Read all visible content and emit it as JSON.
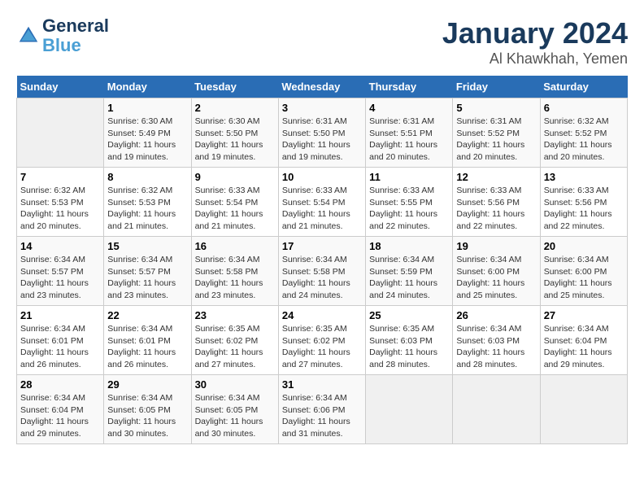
{
  "header": {
    "logo_line1": "General",
    "logo_line2": "Blue",
    "month": "January 2024",
    "location": "Al Khawkhah, Yemen"
  },
  "days_of_week": [
    "Sunday",
    "Monday",
    "Tuesday",
    "Wednesday",
    "Thursday",
    "Friday",
    "Saturday"
  ],
  "weeks": [
    [
      {
        "day": "",
        "info": ""
      },
      {
        "day": "1",
        "info": "Sunrise: 6:30 AM\nSunset: 5:49 PM\nDaylight: 11 hours\nand 19 minutes."
      },
      {
        "day": "2",
        "info": "Sunrise: 6:30 AM\nSunset: 5:50 PM\nDaylight: 11 hours\nand 19 minutes."
      },
      {
        "day": "3",
        "info": "Sunrise: 6:31 AM\nSunset: 5:50 PM\nDaylight: 11 hours\nand 19 minutes."
      },
      {
        "day": "4",
        "info": "Sunrise: 6:31 AM\nSunset: 5:51 PM\nDaylight: 11 hours\nand 20 minutes."
      },
      {
        "day": "5",
        "info": "Sunrise: 6:31 AM\nSunset: 5:52 PM\nDaylight: 11 hours\nand 20 minutes."
      },
      {
        "day": "6",
        "info": "Sunrise: 6:32 AM\nSunset: 5:52 PM\nDaylight: 11 hours\nand 20 minutes."
      }
    ],
    [
      {
        "day": "7",
        "info": "Sunrise: 6:32 AM\nSunset: 5:53 PM\nDaylight: 11 hours\nand 20 minutes."
      },
      {
        "day": "8",
        "info": "Sunrise: 6:32 AM\nSunset: 5:53 PM\nDaylight: 11 hours\nand 21 minutes."
      },
      {
        "day": "9",
        "info": "Sunrise: 6:33 AM\nSunset: 5:54 PM\nDaylight: 11 hours\nand 21 minutes."
      },
      {
        "day": "10",
        "info": "Sunrise: 6:33 AM\nSunset: 5:54 PM\nDaylight: 11 hours\nand 21 minutes."
      },
      {
        "day": "11",
        "info": "Sunrise: 6:33 AM\nSunset: 5:55 PM\nDaylight: 11 hours\nand 22 minutes."
      },
      {
        "day": "12",
        "info": "Sunrise: 6:33 AM\nSunset: 5:56 PM\nDaylight: 11 hours\nand 22 minutes."
      },
      {
        "day": "13",
        "info": "Sunrise: 6:33 AM\nSunset: 5:56 PM\nDaylight: 11 hours\nand 22 minutes."
      }
    ],
    [
      {
        "day": "14",
        "info": "Sunrise: 6:34 AM\nSunset: 5:57 PM\nDaylight: 11 hours\nand 23 minutes."
      },
      {
        "day": "15",
        "info": "Sunrise: 6:34 AM\nSunset: 5:57 PM\nDaylight: 11 hours\nand 23 minutes."
      },
      {
        "day": "16",
        "info": "Sunrise: 6:34 AM\nSunset: 5:58 PM\nDaylight: 11 hours\nand 23 minutes."
      },
      {
        "day": "17",
        "info": "Sunrise: 6:34 AM\nSunset: 5:58 PM\nDaylight: 11 hours\nand 24 minutes."
      },
      {
        "day": "18",
        "info": "Sunrise: 6:34 AM\nSunset: 5:59 PM\nDaylight: 11 hours\nand 24 minutes."
      },
      {
        "day": "19",
        "info": "Sunrise: 6:34 AM\nSunset: 6:00 PM\nDaylight: 11 hours\nand 25 minutes."
      },
      {
        "day": "20",
        "info": "Sunrise: 6:34 AM\nSunset: 6:00 PM\nDaylight: 11 hours\nand 25 minutes."
      }
    ],
    [
      {
        "day": "21",
        "info": "Sunrise: 6:34 AM\nSunset: 6:01 PM\nDaylight: 11 hours\nand 26 minutes."
      },
      {
        "day": "22",
        "info": "Sunrise: 6:34 AM\nSunset: 6:01 PM\nDaylight: 11 hours\nand 26 minutes."
      },
      {
        "day": "23",
        "info": "Sunrise: 6:35 AM\nSunset: 6:02 PM\nDaylight: 11 hours\nand 27 minutes."
      },
      {
        "day": "24",
        "info": "Sunrise: 6:35 AM\nSunset: 6:02 PM\nDaylight: 11 hours\nand 27 minutes."
      },
      {
        "day": "25",
        "info": "Sunrise: 6:35 AM\nSunset: 6:03 PM\nDaylight: 11 hours\nand 28 minutes."
      },
      {
        "day": "26",
        "info": "Sunrise: 6:34 AM\nSunset: 6:03 PM\nDaylight: 11 hours\nand 28 minutes."
      },
      {
        "day": "27",
        "info": "Sunrise: 6:34 AM\nSunset: 6:04 PM\nDaylight: 11 hours\nand 29 minutes."
      }
    ],
    [
      {
        "day": "28",
        "info": "Sunrise: 6:34 AM\nSunset: 6:04 PM\nDaylight: 11 hours\nand 29 minutes."
      },
      {
        "day": "29",
        "info": "Sunrise: 6:34 AM\nSunset: 6:05 PM\nDaylight: 11 hours\nand 30 minutes."
      },
      {
        "day": "30",
        "info": "Sunrise: 6:34 AM\nSunset: 6:05 PM\nDaylight: 11 hours\nand 30 minutes."
      },
      {
        "day": "31",
        "info": "Sunrise: 6:34 AM\nSunset: 6:06 PM\nDaylight: 11 hours\nand 31 minutes."
      },
      {
        "day": "",
        "info": ""
      },
      {
        "day": "",
        "info": ""
      },
      {
        "day": "",
        "info": ""
      }
    ]
  ]
}
